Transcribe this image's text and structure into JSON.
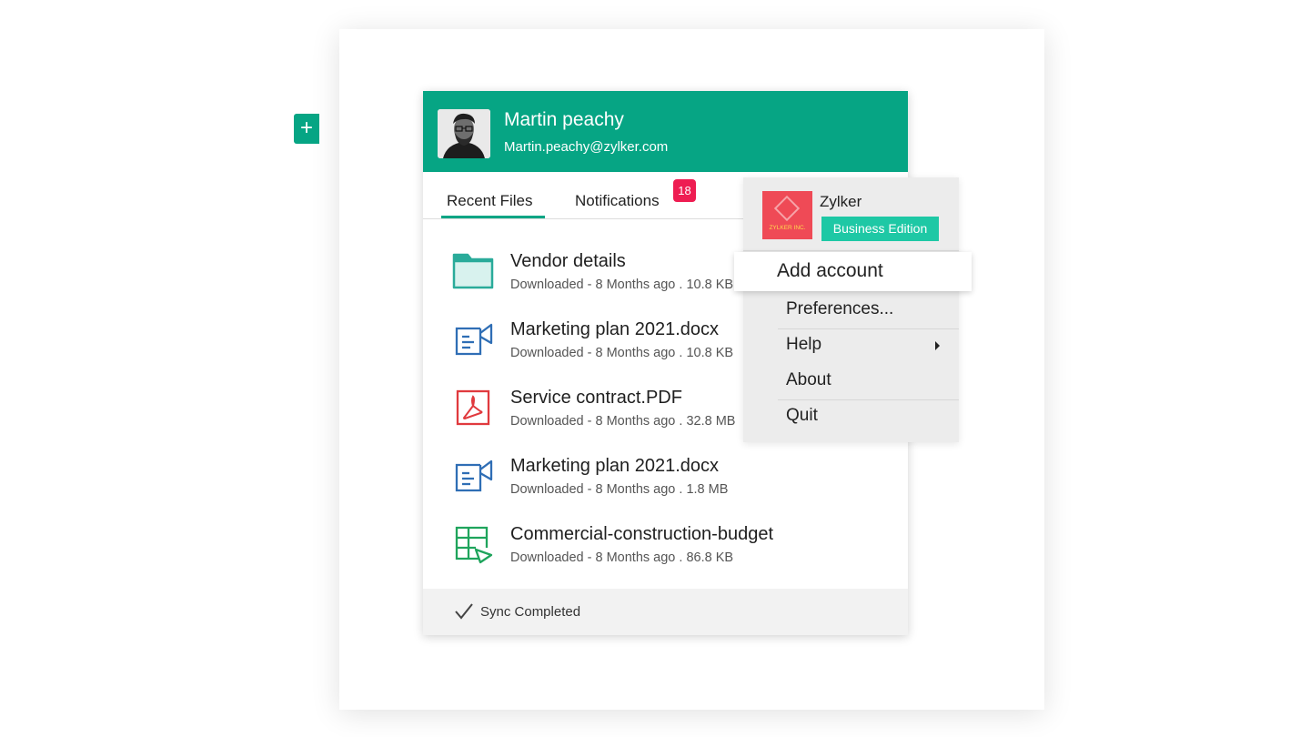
{
  "profile": {
    "name": "Martin peachy",
    "email": "Martin.peachy@zylker.com"
  },
  "tabs": [
    {
      "label": "Recent Files",
      "active": true
    },
    {
      "label": "Notifications",
      "badge": "18"
    }
  ],
  "add_button_label": "+",
  "files": [
    {
      "name": "Vendor details",
      "meta": "Downloaded - 8 Months ago . 10.8 KB",
      "icon": "folder-icon"
    },
    {
      "name": "Marketing plan 2021.docx",
      "meta": "Downloaded - 8 Months ago . 10.8 KB",
      "icon": "presentation-doc-icon"
    },
    {
      "name": "Service contract.PDF",
      "meta": "Downloaded - 8 Months ago . 32.8 MB",
      "icon": "pdf-icon"
    },
    {
      "name": "Marketing plan 2021.docx",
      "meta": "Downloaded - 8 Months ago . 1.8 MB",
      "icon": "presentation-doc-icon"
    },
    {
      "name": "Commercial-construction-budget",
      "meta": "Downloaded - 8 Months ago . 86.8 KB",
      "icon": "spreadsheet-icon"
    }
  ],
  "footer": {
    "status": "Sync Completed"
  },
  "account_menu": {
    "org_name": "Zylker",
    "org_logo_text": "ZYLKER INC.",
    "edition": "Business Edition",
    "items": [
      "Add account",
      "Preferences...",
      "Help",
      "About",
      "Quit"
    ]
  },
  "colors": {
    "brand": "#06a584",
    "badge": "#ee1d52",
    "edition": "#1ec8a5",
    "folder": "#2aab9a",
    "doc": "#2f6eb5",
    "pdf": "#e03a3e",
    "sheet": "#1fa45c"
  }
}
